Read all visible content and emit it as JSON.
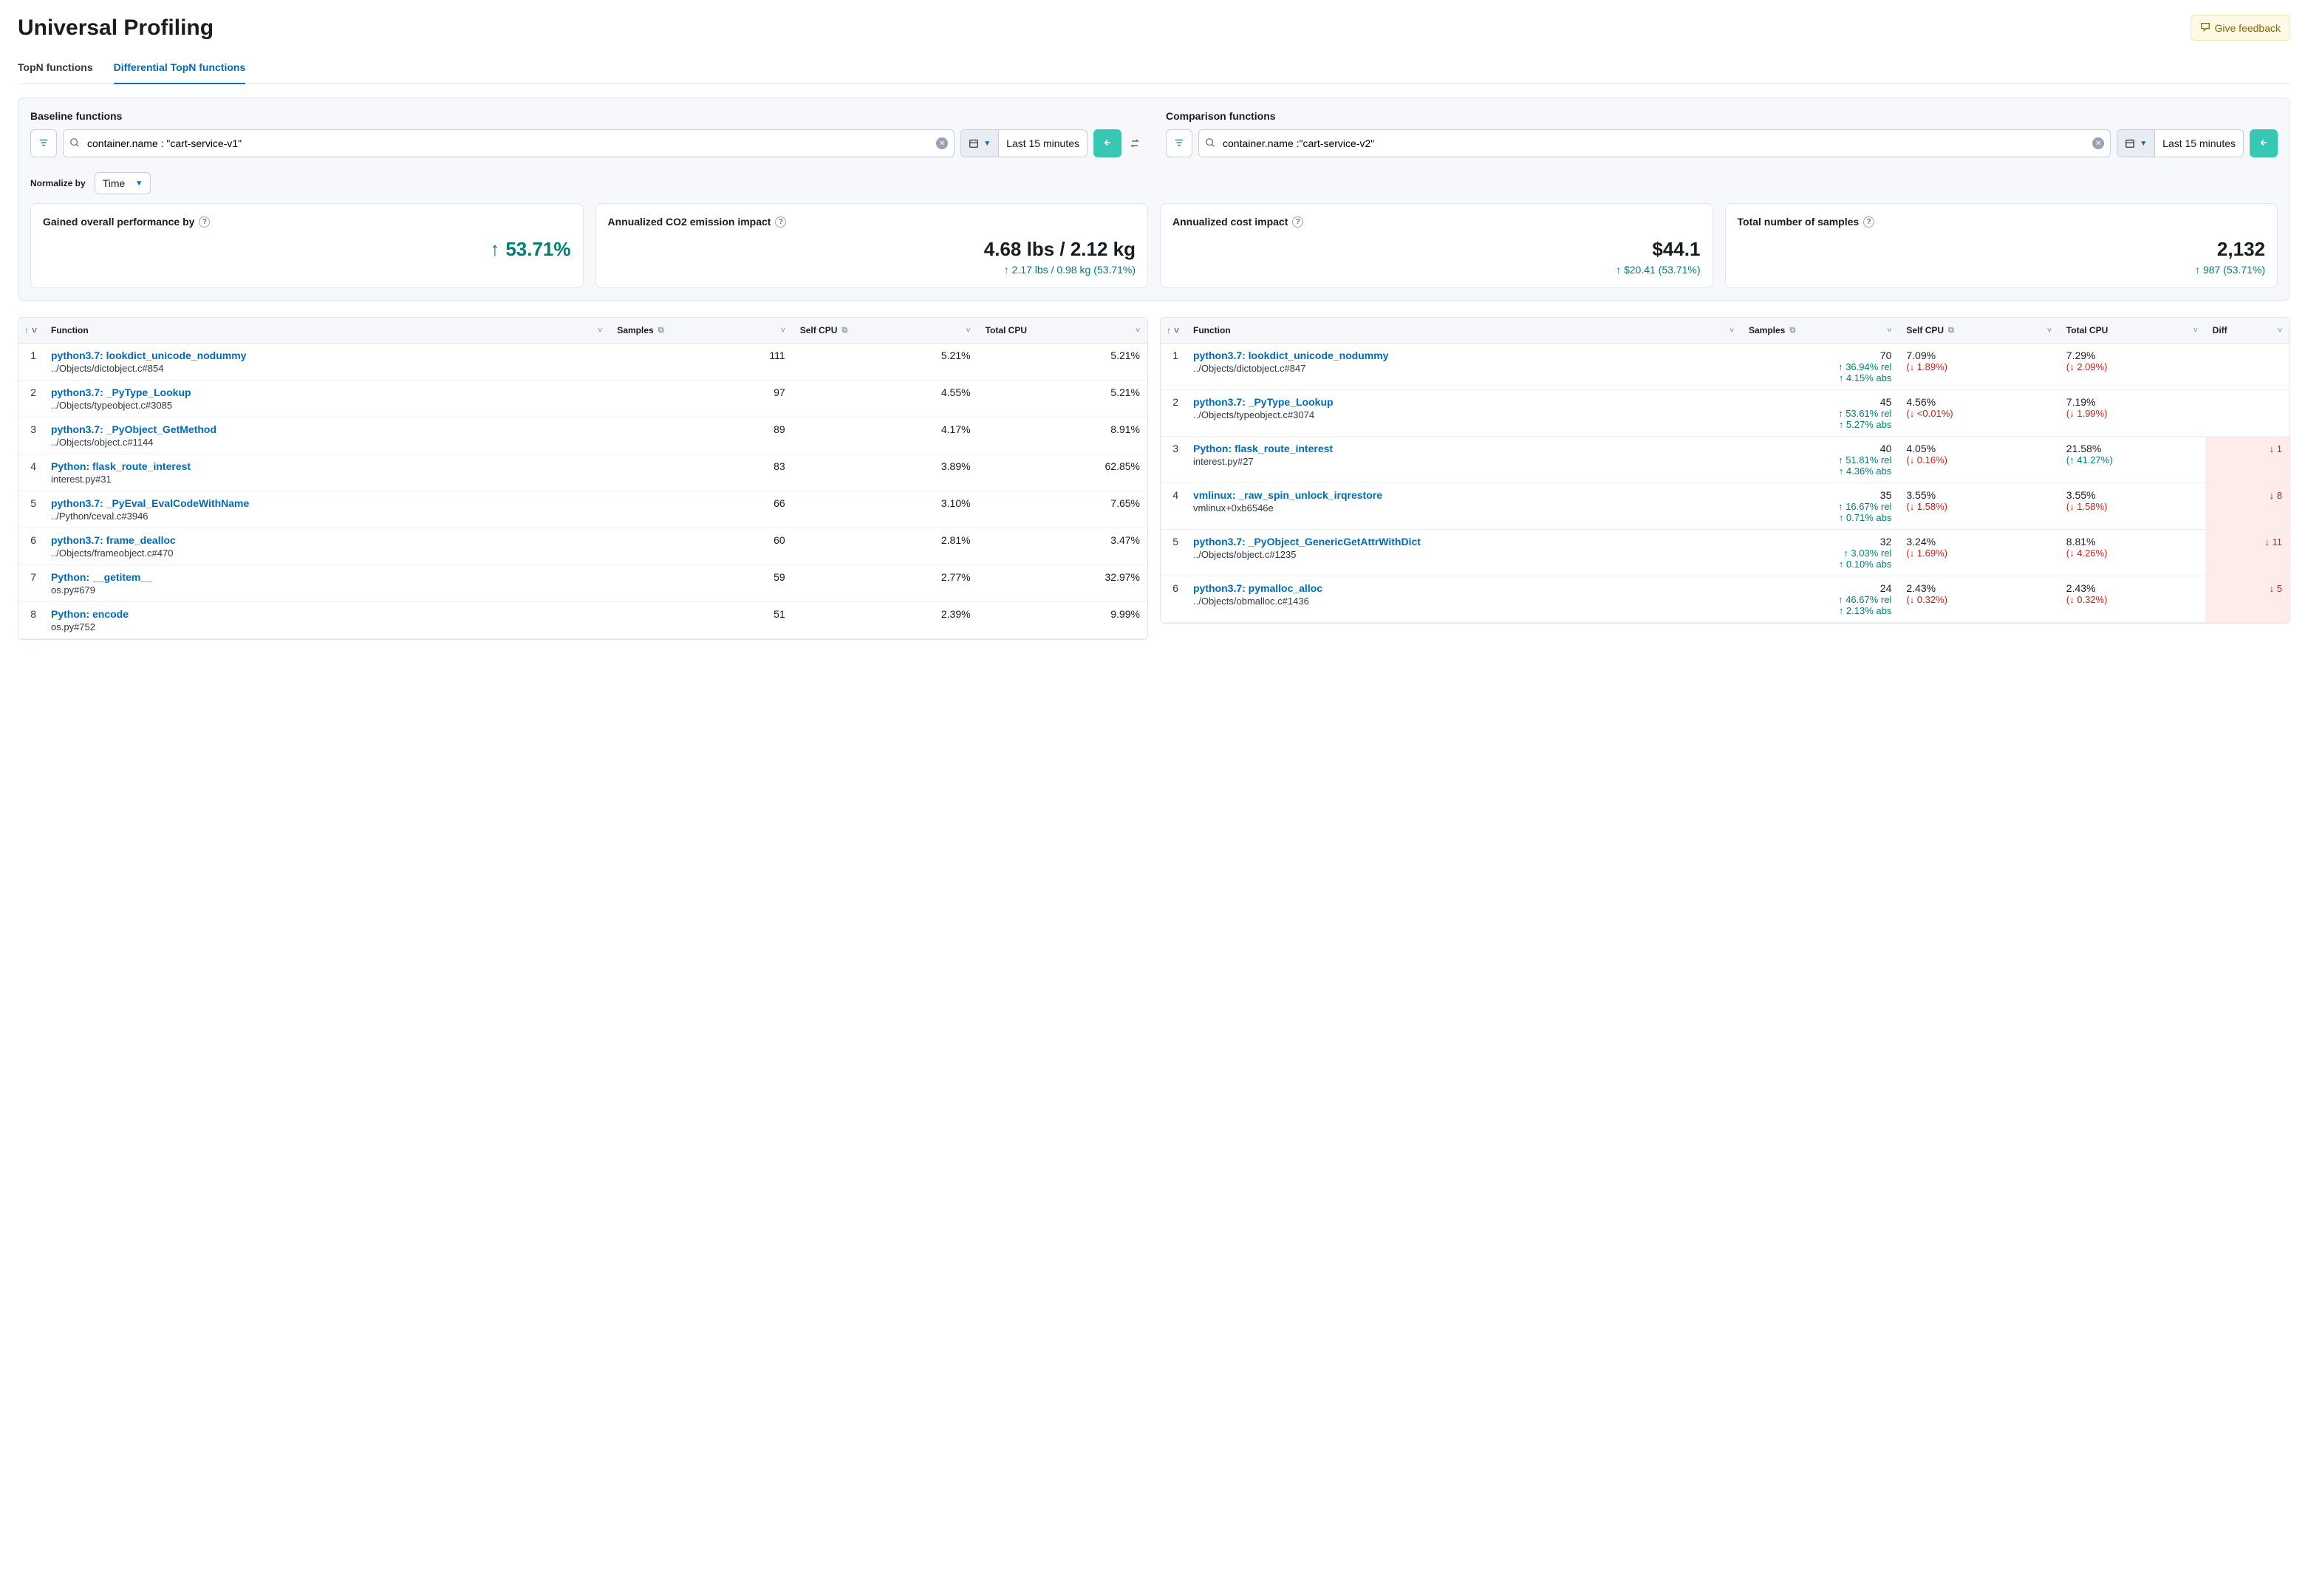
{
  "header": {
    "title": "Universal Profiling",
    "feedback": "Give feedback"
  },
  "tabs": {
    "topn": "TopN functions",
    "diff": "Differential TopN functions"
  },
  "filters": {
    "baseline": {
      "label": "Baseline functions",
      "query": "container.name : \"cart-service-v1\"",
      "time": "Last 15 minutes"
    },
    "comparison": {
      "label": "Comparison functions",
      "query": "container.name :\"cart-service-v2\"",
      "time": "Last 15 minutes"
    }
  },
  "normalize": {
    "label": "Normalize by",
    "value": "Time"
  },
  "cards": {
    "perf": {
      "label": "Gained overall performance by",
      "value": "53.71%"
    },
    "co2": {
      "label": "Annualized CO2 emission impact",
      "value": "4.68 lbs / 2.12 kg",
      "sub": "2.17 lbs / 0.98 kg (53.71%)"
    },
    "cost": {
      "label": "Annualized cost impact",
      "value": "$44.1",
      "sub": "$20.41 (53.71%)"
    },
    "samples": {
      "label": "Total number of samples",
      "value": "2,132",
      "sub": "987 (53.71%)"
    }
  },
  "tableHeaders": {
    "function": "Function",
    "samples": "Samples",
    "selfcpu": "Self CPU",
    "totalcpu": "Total CPU",
    "diff": "Diff"
  },
  "baselineRows": [
    {
      "rank": "1",
      "fn": "python3.7: lookdict_unicode_nodummy",
      "path": "../Objects/dictobject.c#854",
      "samples": "111",
      "self": "5.21%",
      "total": "5.21%"
    },
    {
      "rank": "2",
      "fn": "python3.7: _PyType_Lookup",
      "path": "../Objects/typeobject.c#3085",
      "samples": "97",
      "self": "4.55%",
      "total": "5.21%"
    },
    {
      "rank": "3",
      "fn": "python3.7: _PyObject_GetMethod",
      "path": "../Objects/object.c#1144",
      "samples": "89",
      "self": "4.17%",
      "total": "8.91%"
    },
    {
      "rank": "4",
      "fn": "Python: flask_route_interest",
      "path": "interest.py#31",
      "samples": "83",
      "self": "3.89%",
      "total": "62.85%"
    },
    {
      "rank": "5",
      "fn": "python3.7: _PyEval_EvalCodeWithName",
      "path": "../Python/ceval.c#3946",
      "samples": "66",
      "self": "3.10%",
      "total": "7.65%"
    },
    {
      "rank": "6",
      "fn": "python3.7: frame_dealloc",
      "path": "../Objects/frameobject.c#470",
      "samples": "60",
      "self": "2.81%",
      "total": "3.47%"
    },
    {
      "rank": "7",
      "fn": "Python: __getitem__",
      "path": "os.py#679",
      "samples": "59",
      "self": "2.77%",
      "total": "32.97%"
    },
    {
      "rank": "8",
      "fn": "Python: encode",
      "path": "os.py#752",
      "samples": "51",
      "self": "2.39%",
      "total": "9.99%"
    }
  ],
  "comparisonRows": [
    {
      "rank": "1",
      "fn": "python3.7: lookdict_unicode_nodummy",
      "path": "../Objects/dictobject.c#847",
      "samples": "70",
      "srel": "36.94% rel",
      "sabs": "4.15% abs",
      "self": "7.09%",
      "selfd": "1.89%",
      "selfdir": "down",
      "total": "7.29%",
      "totald": "2.09%",
      "totaldir": "down"
    },
    {
      "rank": "2",
      "fn": "python3.7: _PyType_Lookup",
      "path": "../Objects/typeobject.c#3074",
      "samples": "45",
      "srel": "53.61% rel",
      "sabs": "5.27% abs",
      "self": "4.56%",
      "selfd": "<0.01%",
      "selfdir": "down",
      "total": "7.19%",
      "totald": "1.99%",
      "totaldir": "down"
    },
    {
      "rank": "3",
      "fn": "Python: flask_route_interest",
      "path": "interest.py#27",
      "samples": "40",
      "srel": "51.81% rel",
      "sabs": "4.36% abs",
      "self": "4.05%",
      "selfd": "0.16%",
      "selfdir": "down",
      "total": "21.58%",
      "totald": "41.27%",
      "totaldir": "up",
      "diff": "1",
      "diffdir": "down",
      "hl": true
    },
    {
      "rank": "4",
      "fn": "vmlinux: _raw_spin_unlock_irqrestore",
      "path": "vmlinux+0xb6546e",
      "samples": "35",
      "srel": "16.67% rel",
      "sabs": "0.71% abs",
      "self": "3.55%",
      "selfd": "1.58%",
      "selfdir": "down",
      "total": "3.55%",
      "totald": "1.58%",
      "totaldir": "down",
      "diff": "8",
      "diffdir": "down",
      "hl": true
    },
    {
      "rank": "5",
      "fn": "python3.7: _PyObject_GenericGetAttrWithDict",
      "path": "../Objects/object.c#1235",
      "samples": "32",
      "srel": "3.03% rel",
      "sabs": "0.10% abs",
      "self": "3.24%",
      "selfd": "1.69%",
      "selfdir": "down",
      "total": "8.81%",
      "totald": "4.26%",
      "totaldir": "down",
      "diff": "11",
      "diffdir": "down",
      "hl": true
    },
    {
      "rank": "6",
      "fn": "python3.7: pymalloc_alloc",
      "path": "../Objects/obmalloc.c#1436",
      "samples": "24",
      "srel": "46.67% rel",
      "sabs": "2.13% abs",
      "self": "2.43%",
      "selfd": "0.32%",
      "selfdir": "down",
      "total": "2.43%",
      "totald": "0.32%",
      "totaldir": "down",
      "diff": "5",
      "diffdir": "down",
      "hl": true
    }
  ]
}
